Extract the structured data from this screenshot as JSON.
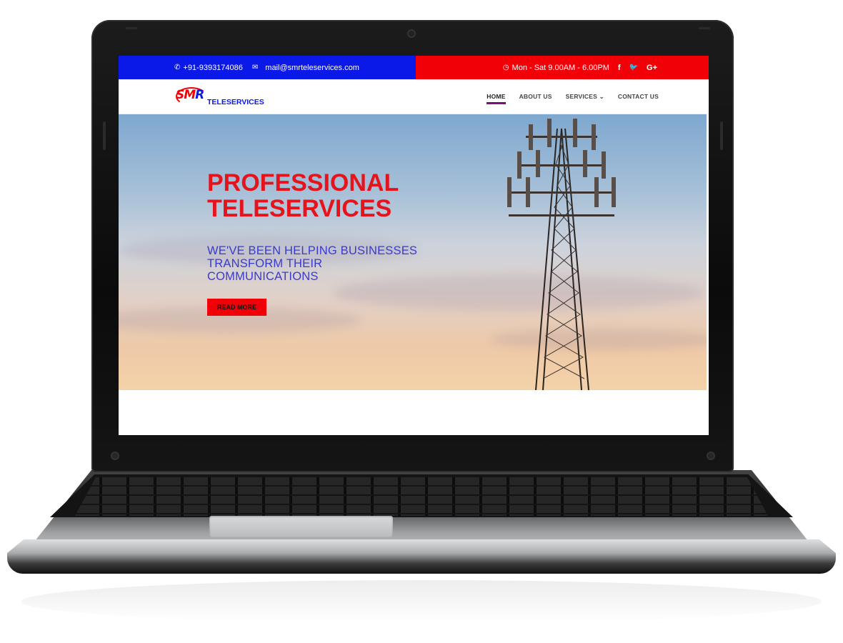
{
  "topbar": {
    "phone_icon": "phone-icon",
    "phone": "+91-9393174086",
    "mail_icon": "envelope-icon",
    "email": "mail@smrteleservices.com",
    "clock_icon": "clock-icon",
    "hours": "Mon - Sat 9.00AM - 6.00PM",
    "social": {
      "facebook": "f",
      "twitter": "🐦",
      "google_plus": "G+"
    },
    "colors": {
      "left": "#0a18e8",
      "right": "#f20008"
    }
  },
  "logo": {
    "mark_main": "SM",
    "mark_r": "R",
    "text": "TELESERVICES"
  },
  "nav": {
    "items": [
      {
        "label": "HOME",
        "active": true
      },
      {
        "label": "ABOUT US",
        "active": false
      },
      {
        "label": "SERVICES ⌄",
        "active": false
      },
      {
        "label": "CONTACT US",
        "active": false
      }
    ]
  },
  "hero": {
    "title_line1": "PROFESSIONAL",
    "title_line2": "TELESERVICES",
    "subtitle": "WE'VE BEEN HELPING BUSINESSES TRANSFORM THEIR COMMUNICATIONS",
    "button": "READ MORE",
    "accent": "#e5141c"
  }
}
